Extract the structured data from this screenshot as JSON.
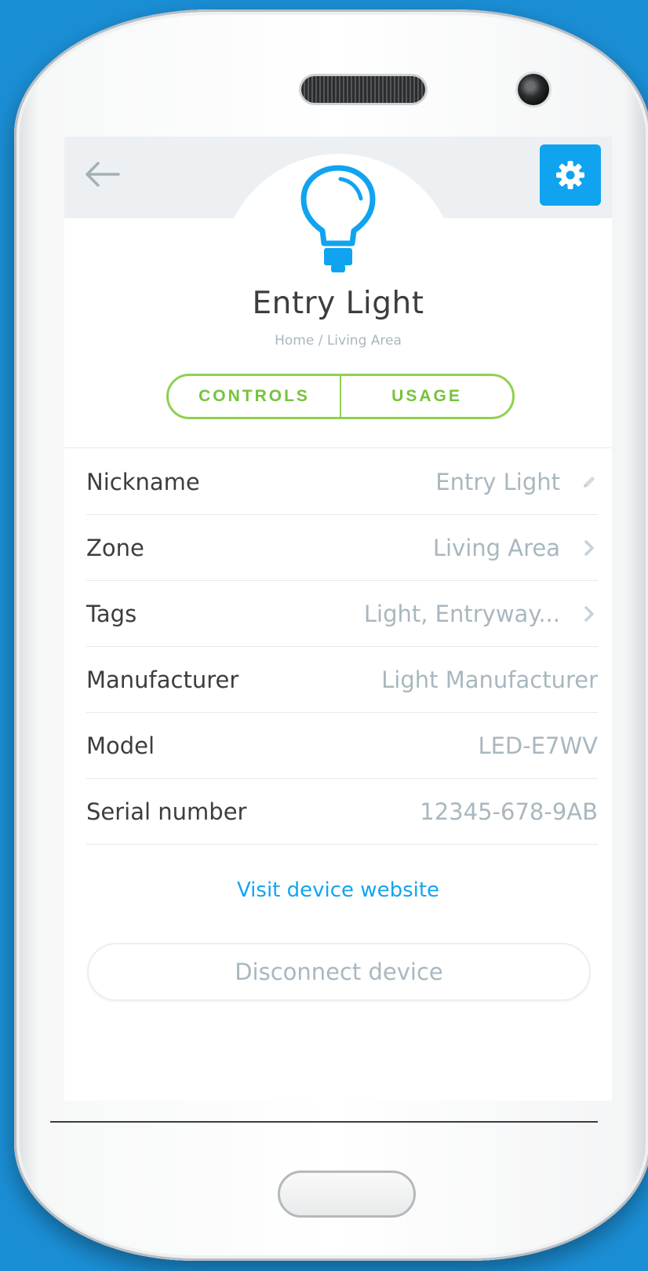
{
  "header": {
    "back_icon": "arrow-left-icon",
    "settings_icon": "gear-icon"
  },
  "device": {
    "icon": "lightbulb-icon",
    "title": "Entry Light",
    "breadcrumb": "Home / Living Area"
  },
  "tabs": [
    {
      "label": "CONTROLS"
    },
    {
      "label": "USAGE"
    }
  ],
  "details": [
    {
      "label": "Nickname",
      "value": "Entry Light",
      "icon": "pencil-icon"
    },
    {
      "label": "Zone",
      "value": "Living Area",
      "icon": "chevron-right-icon"
    },
    {
      "label": "Tags",
      "value": "Light, Entryway...",
      "icon": "chevron-right-icon"
    },
    {
      "label": "Manufacturer",
      "value": "Light Manufacturer"
    },
    {
      "label": "Model",
      "value": "LED-E7WV"
    },
    {
      "label": "Serial number",
      "value": "12345-678-9AB"
    }
  ],
  "links": {
    "visit_website": "Visit device website"
  },
  "actions": {
    "disconnect": "Disconnect device"
  },
  "colors": {
    "background": "#1b8fd6",
    "accent_blue": "#10a3f0",
    "accent_green": "#8fd14f",
    "muted_text": "#a9b7bf"
  }
}
